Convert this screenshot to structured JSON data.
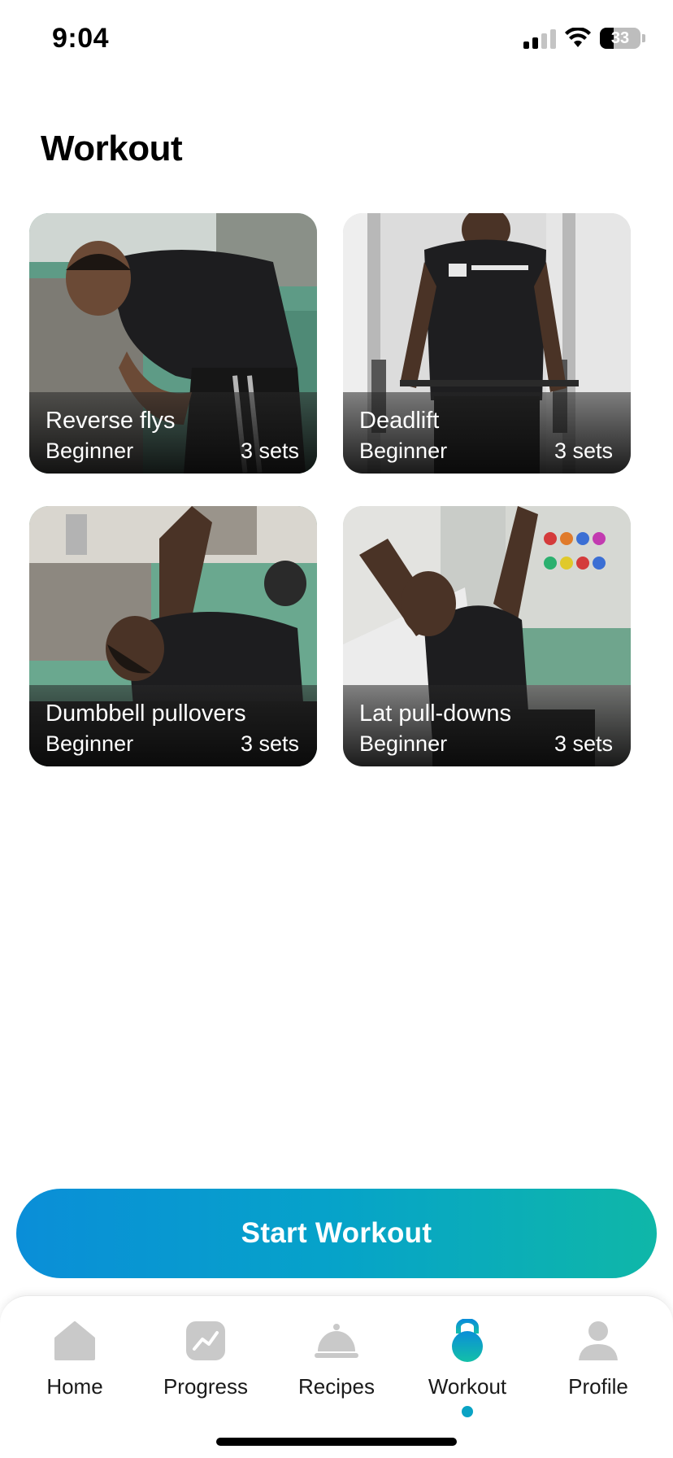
{
  "status_bar": {
    "time": "9:04",
    "battery": "33",
    "battery_level": 0.33
  },
  "page": {
    "title": "Workout"
  },
  "exercises": [
    {
      "name": "Reverse flys",
      "level": "Beginner",
      "sets": "3 sets"
    },
    {
      "name": "Deadlift",
      "level": "Beginner",
      "sets": "3 sets"
    },
    {
      "name": "Dumbbell pullovers",
      "level": "Beginner",
      "sets": "3 sets"
    },
    {
      "name": "Lat pull-downs",
      "level": "Beginner",
      "sets": "3 sets"
    }
  ],
  "actions": {
    "start_label": "Start Workout"
  },
  "tab_bar": {
    "items": [
      {
        "label": "Home",
        "icon": "home-icon"
      },
      {
        "label": "Progress",
        "icon": "chart-icon"
      },
      {
        "label": "Recipes",
        "icon": "cloche-icon"
      },
      {
        "label": "Workout",
        "icon": "kettlebell-icon",
        "active": true
      },
      {
        "label": "Profile",
        "icon": "person-icon"
      }
    ]
  },
  "colors": {
    "accent_start": "#0a8ed8",
    "accent_end": "#0fb7a8",
    "tab_inactive": "#c9c9c9"
  }
}
